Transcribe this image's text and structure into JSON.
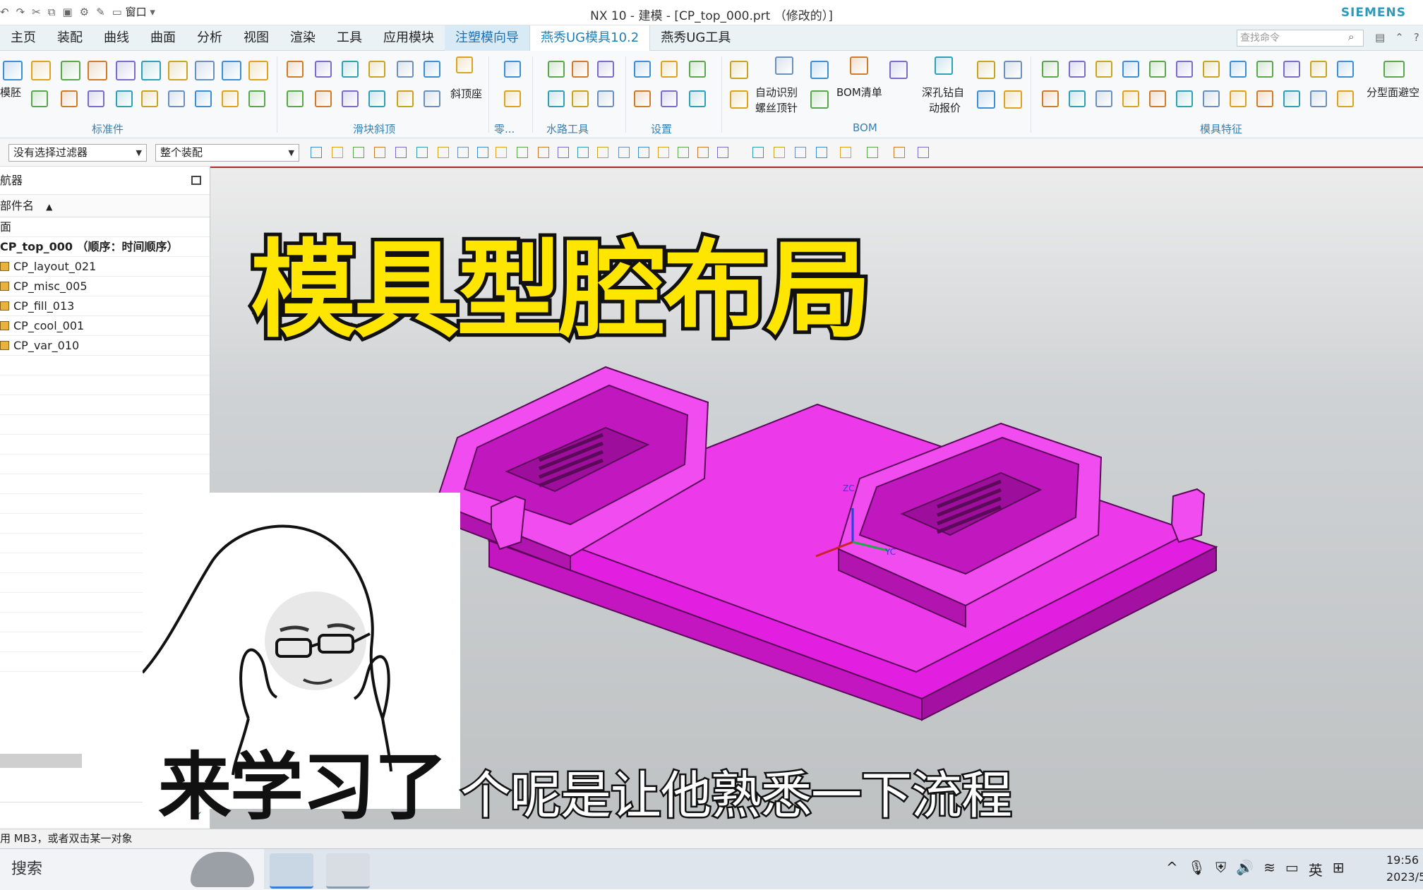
{
  "titlebar": {
    "window_menu": "窗口",
    "title": "NX 10 - 建模 - [CP_top_000.prt （修改的）]",
    "brand": "SIEMENS"
  },
  "menubar": {
    "tabs": [
      "主页",
      "装配",
      "曲线",
      "曲面",
      "分析",
      "视图",
      "渲染",
      "工具",
      "应用模块",
      "注塑模向导",
      "燕秀UG模具10.2",
      "燕秀UG工具"
    ],
    "search_placeholder": "查找命令"
  },
  "ribbon": {
    "groups": [
      "标准件",
      "滑块斜顶",
      "零...",
      "水路工具",
      "设置",
      "BOM",
      "模具特征"
    ],
    "labels": {
      "mold_base": "模胚",
      "lifter_seat": "斜顶座",
      "auto_screw": "自动识别",
      "auto_screw2": "螺丝顶针",
      "bom_list": "BOM清单",
      "deep_drill": "深孔钻自",
      "deep_drill2": "动报价",
      "parting_avoid": "分型面避空"
    }
  },
  "selection_bar": {
    "filter": "没有选择过滤器",
    "assembly": "整个装配"
  },
  "navigator": {
    "title": "航器",
    "column": "部件名",
    "rows": [
      {
        "label": "面",
        "bold": false,
        "cube": false
      },
      {
        "label": "CP_top_000 （顺序：时间顺序）",
        "bold": true,
        "cube": false
      },
      {
        "label": "CP_layout_021",
        "bold": false,
        "cube": true
      },
      {
        "label": "CP_misc_005",
        "bold": false,
        "cube": true
      },
      {
        "label": "CP_fill_013",
        "bold": false,
        "cube": true
      },
      {
        "label": "CP_cool_001",
        "bold": false,
        "cube": true
      },
      {
        "label": "CP_var_010",
        "bold": false,
        "cube": true
      }
    ]
  },
  "viewport": {
    "headline": "模具型腔布局",
    "meme_caption": "来学习了",
    "subtitle": "个呢是让他熟悉一下流程",
    "axis_zc": "ZC",
    "axis_yc": "YC",
    "model_color": "#e21ee0"
  },
  "statusbar": {
    "text": "用 MB3，或者双击某一对象"
  },
  "taskbar": {
    "search": "搜索",
    "ime": "英",
    "clock_time": "19:56",
    "clock_date": "2023/5"
  }
}
